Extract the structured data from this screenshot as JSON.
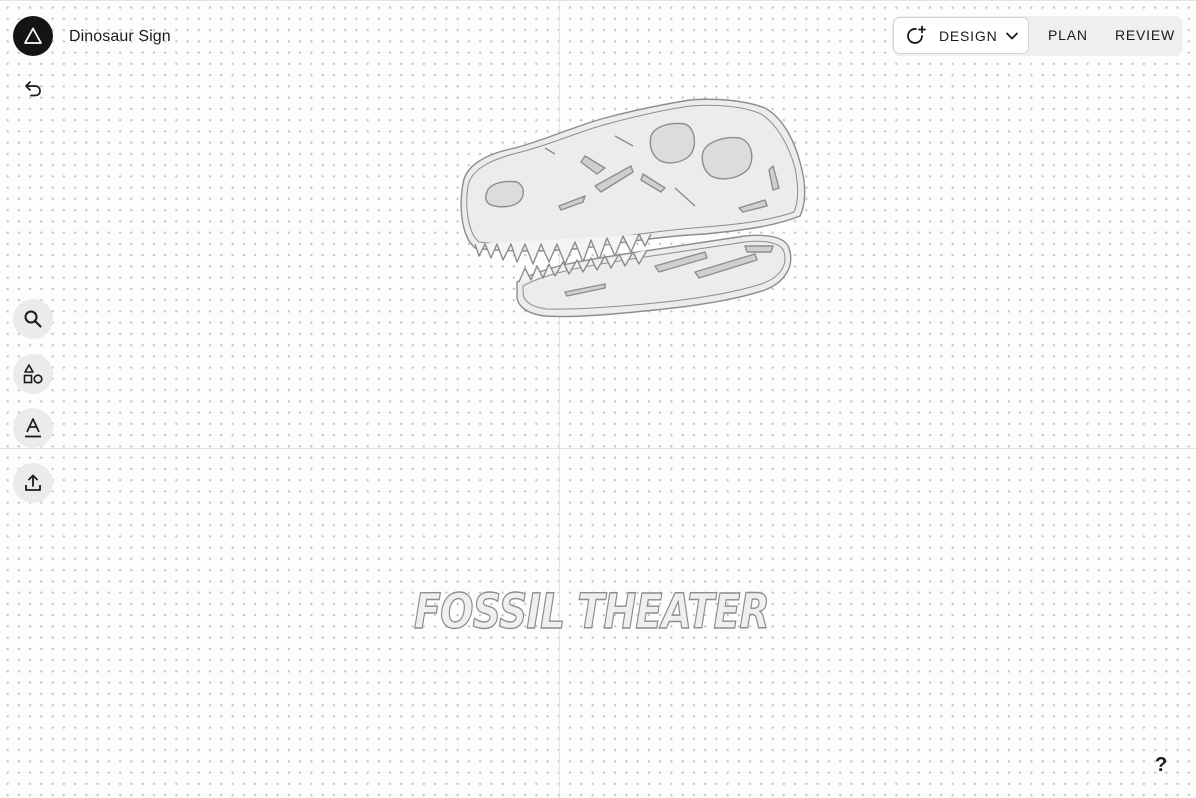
{
  "project": {
    "title": "Dinosaur Sign"
  },
  "modes": {
    "design_label": "DESIGN",
    "plan_label": "PLAN",
    "review_label": "REVIEW",
    "active": "DESIGN"
  },
  "canvas": {
    "sign_text": "FOSSIL THEATER",
    "artwork": "t-rex-skull-outline"
  },
  "tools": [
    {
      "name": "search",
      "icon": "search-icon"
    },
    {
      "name": "shapes",
      "icon": "shapes-icon"
    },
    {
      "name": "text",
      "icon": "text-icon"
    },
    {
      "name": "upload",
      "icon": "upload-icon"
    }
  ],
  "help": {
    "label": "?"
  },
  "colors": {
    "logo_bg": "#141414",
    "toolbar_bg": "#efefef",
    "tool_bg": "#ebebeb",
    "artwork_stroke": "#8d8d8d",
    "artwork_fill": "#efefef"
  }
}
